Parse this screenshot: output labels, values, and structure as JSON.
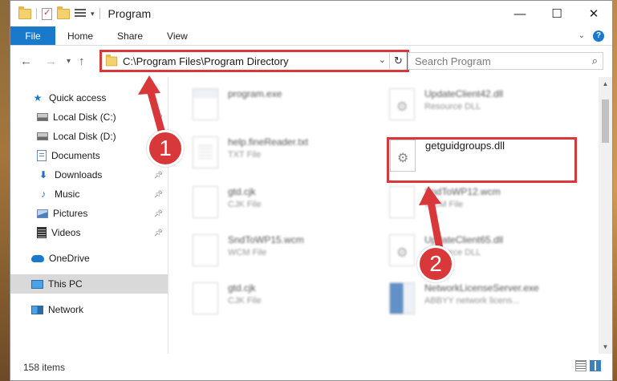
{
  "window": {
    "title": "Program",
    "controls": {
      "minimize": "—",
      "maximize": "☐",
      "close": "✕"
    }
  },
  "ribbon": {
    "tabs": [
      "File",
      "Home",
      "Share",
      "View"
    ]
  },
  "address": {
    "path": "C:\\Program Files\\Program Directory"
  },
  "search": {
    "placeholder": "Search Program"
  },
  "nav": {
    "quick_access": "Quick access",
    "items": [
      {
        "label": "Local Disk (C:)",
        "icon": "drive-icon",
        "pinned": true
      },
      {
        "label": "Local Disk (D:)",
        "icon": "drive-icon",
        "pinned": false
      },
      {
        "label": "Documents",
        "icon": "documents-icon",
        "pinned": true
      },
      {
        "label": "Downloads",
        "icon": "downloads-icon",
        "pinned": true
      },
      {
        "label": "Music",
        "icon": "music-icon",
        "pinned": true
      },
      {
        "label": "Pictures",
        "icon": "pictures-icon",
        "pinned": true
      },
      {
        "label": "Videos",
        "icon": "videos-icon",
        "pinned": true
      }
    ],
    "onedrive": "OneDrive",
    "this_pc": "This PC",
    "network": "Network"
  },
  "files": [
    {
      "name": "program.exe",
      "type": ""
    },
    {
      "name": "UpdateClient42.dll",
      "type": "Resource DLL"
    },
    {
      "name": "help.fineReader.txt",
      "type": "TXT File"
    },
    {
      "name": "getguidgroups.dll",
      "type": ""
    },
    {
      "name": "gtd.cjk",
      "type": "CJK File"
    },
    {
      "name": "SndToWP12.wcm",
      "type": "WCM File"
    },
    {
      "name": "SndToWP15.wcm",
      "type": "WCM File"
    },
    {
      "name": "UpdateClient65.dll",
      "type": "Resource DLL"
    },
    {
      "name": "gtd.cjk",
      "type": "CJK File"
    },
    {
      "name": "NetworkLicenseServer.exe",
      "type": "ABBYY network licens..."
    }
  ],
  "status": {
    "item_count": "158 items"
  },
  "annotations": {
    "step1": "1",
    "step2": "2"
  },
  "colors": {
    "accent": "#1979ca",
    "highlight": "#d9383a"
  }
}
